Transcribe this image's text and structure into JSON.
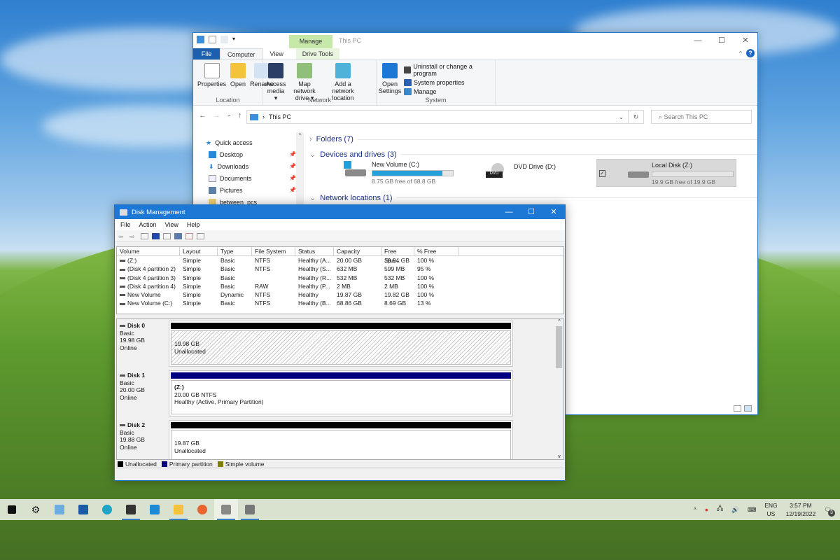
{
  "explorer": {
    "window_title": "This PC",
    "contextual_tab": "Manage",
    "tabs": [
      "File",
      "Computer",
      "View",
      "Drive Tools"
    ],
    "ribbon": {
      "location": {
        "label": "Location",
        "buttons": [
          "Properties",
          "Open",
          "Rename"
        ]
      },
      "network": {
        "label": "Network",
        "buttons": [
          "Access media ▾",
          "Map network drive ▾",
          "Add a network location"
        ]
      },
      "system": {
        "label": "System",
        "open_settings": "Open Settings",
        "links": [
          "Uninstall or change a program",
          "System properties",
          "Manage"
        ]
      }
    },
    "address": {
      "path": "This PC"
    },
    "search_placeholder": "Search This PC",
    "nav_pane": {
      "quick_access": "Quick access",
      "items": [
        {
          "label": "Desktop",
          "pinned": true
        },
        {
          "label": "Downloads",
          "pinned": true
        },
        {
          "label": "Documents",
          "pinned": true
        },
        {
          "label": "Pictures",
          "pinned": true
        },
        {
          "label": "between_pcs",
          "pinned": false
        }
      ]
    },
    "sections": {
      "folders": "Folders (7)",
      "devices": "Devices and drives (3)",
      "network": "Network locations (1)"
    },
    "drives": [
      {
        "name": "New Volume (C:)",
        "free": "8.75 GB free of 68.8 GB",
        "used_fraction": 0.873
      },
      {
        "name": "DVD Drive (D:)"
      },
      {
        "name": "Local Disk (Z:)",
        "free": "19.9 GB free of 19.9 GB",
        "used_fraction": 0.0,
        "selected": true
      }
    ]
  },
  "disk_management": {
    "title": "Disk Management",
    "menu": [
      "File",
      "Action",
      "View",
      "Help"
    ],
    "columns": [
      "Volume",
      "Layout",
      "Type",
      "File System",
      "Status",
      "Capacity",
      "Free Spa...",
      "% Free"
    ],
    "rows": [
      [
        "(Z:)",
        "Simple",
        "Basic",
        "NTFS",
        "Healthy (A...",
        "20.00 GB",
        "19.94 GB",
        "100 %"
      ],
      [
        "(Disk 4 partition 2)",
        "Simple",
        "Basic",
        "NTFS",
        "Healthy (S...",
        "632 MB",
        "599 MB",
        "95 %"
      ],
      [
        "(Disk 4 partition 3)",
        "Simple",
        "Basic",
        "",
        "Healthy (R...",
        "532 MB",
        "532 MB",
        "100 %"
      ],
      [
        "(Disk 4 partition 4)",
        "Simple",
        "Basic",
        "RAW",
        "Healthy (P...",
        "2 MB",
        "2 MB",
        "100 %"
      ],
      [
        "New Volume",
        "Simple",
        "Dynamic",
        "NTFS",
        "Healthy",
        "19.87 GB",
        "19.82 GB",
        "100 %"
      ],
      [
        "New Volume (C:)",
        "Simple",
        "Basic",
        "NTFS",
        "Healthy (B...",
        "68.86 GB",
        "8.69 GB",
        "13 %"
      ]
    ],
    "disks": [
      {
        "name": "Disk 0",
        "type": "Basic",
        "size": "19.98 GB",
        "state": "Online",
        "part_line1": "19.98 GB",
        "part_line2": "Unallocated",
        "part_line3": "",
        "bar": "#000000",
        "hatched": true
      },
      {
        "name": "Disk 1",
        "type": "Basic",
        "size": "20.00 GB",
        "state": "Online",
        "part_line1": "(Z:)",
        "part_line2": "20.00 GB NTFS",
        "part_line3": "Healthy (Active, Primary Partition)",
        "bar": "#00007f",
        "hatched": false
      },
      {
        "name": "Disk 2",
        "type": "Basic",
        "size": "19.88 GB",
        "state": "Online",
        "part_line1": "19.87 GB",
        "part_line2": "Unallocated",
        "part_line3": "",
        "bar": "#000000",
        "hatched": false
      }
    ],
    "legend": [
      {
        "label": "Unallocated",
        "color": "#000000"
      },
      {
        "label": "Primary partition",
        "color": "#00007f"
      },
      {
        "label": "Simple volume",
        "color": "#808000"
      }
    ]
  },
  "taskbar": {
    "apps": [
      "start",
      "settings",
      "remote-desktop",
      "store",
      "edge",
      "terminal",
      "vscode",
      "file-explorer",
      "firefox",
      "disk-management",
      "device-manager"
    ],
    "lang1": "ENG",
    "lang2": "US",
    "time": "3:57 PM",
    "date": "12/19/2022",
    "notifications": "3"
  }
}
